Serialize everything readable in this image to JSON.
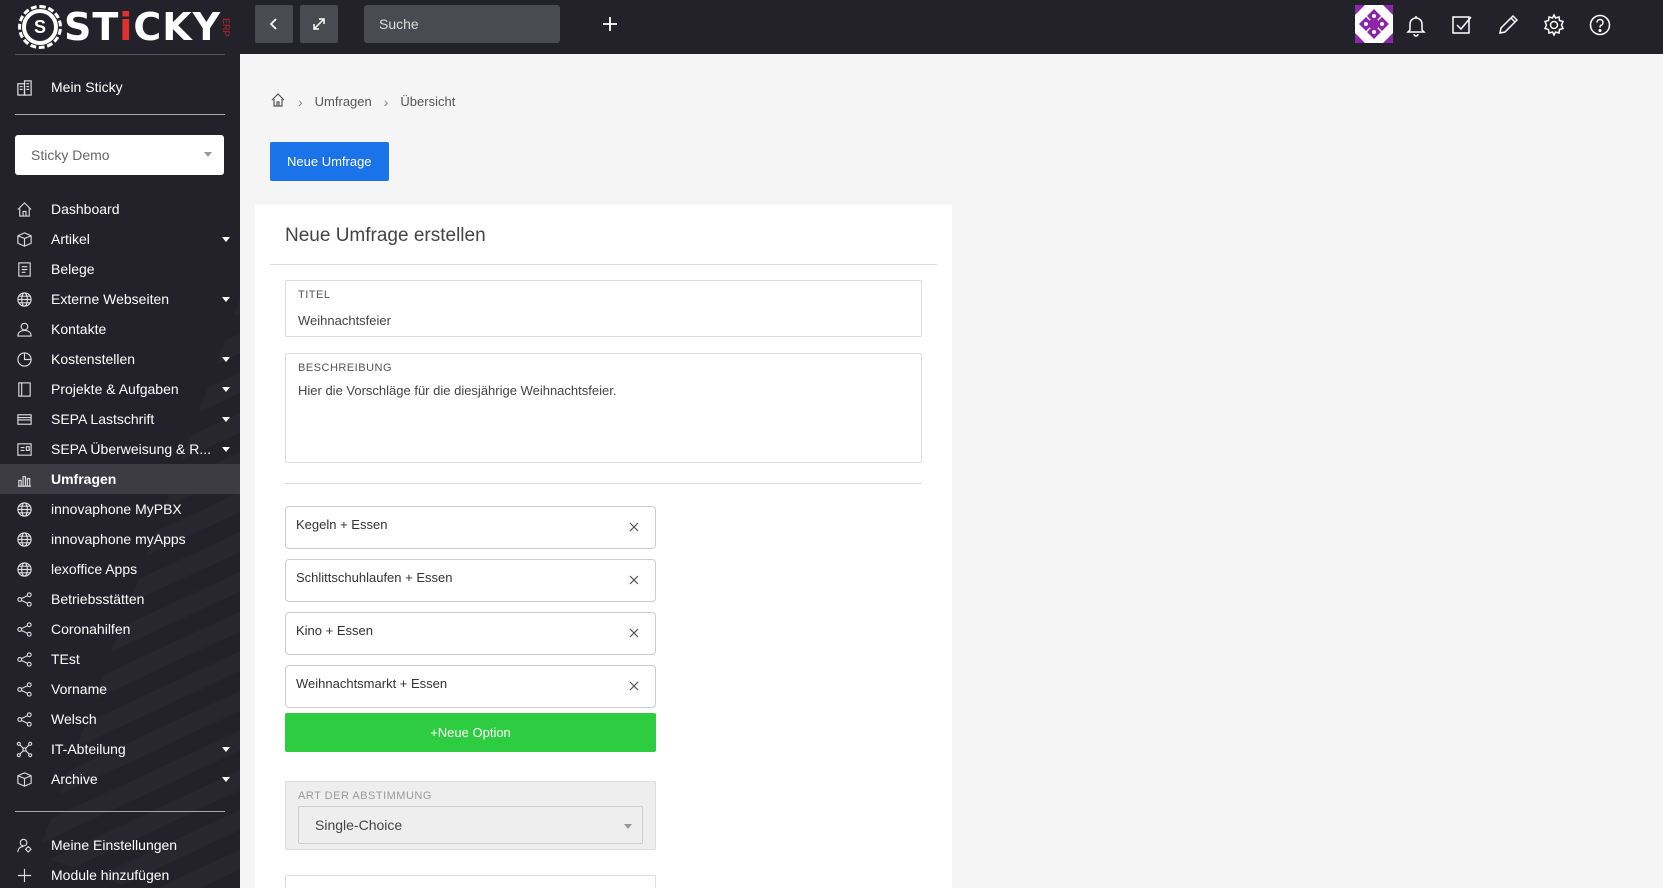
{
  "app": {
    "logo_text_a": "ST",
    "logo_text_b": "i",
    "logo_text_c": "CKY",
    "logo_sub": "ERP"
  },
  "sidebar": {
    "mein_sticky": "Mein Sticky",
    "org_select": "Sticky Demo",
    "items": [
      {
        "label": "Dashboard",
        "icon": "home-icon",
        "caret": false
      },
      {
        "label": "Artikel",
        "icon": "box-icon",
        "caret": true
      },
      {
        "label": "Belege",
        "icon": "document-icon",
        "caret": false
      },
      {
        "label": "Externe Webseiten",
        "icon": "globe-icon",
        "caret": true
      },
      {
        "label": "Kontakte",
        "icon": "contact-icon",
        "caret": false
      },
      {
        "label": "Kostenstellen",
        "icon": "pie-icon",
        "caret": true
      },
      {
        "label": "Projekte & Aufgaben",
        "icon": "book-icon",
        "caret": true
      },
      {
        "label": "SEPA Lastschrift",
        "icon": "card-icon",
        "caret": true
      },
      {
        "label": "SEPA Überweisung & R...",
        "icon": "transfer-icon",
        "caret": true
      },
      {
        "label": "Umfragen",
        "icon": "bar-chart-icon",
        "caret": false,
        "active": true
      },
      {
        "label": "innovaphone MyPBX",
        "icon": "globe-icon",
        "caret": false
      },
      {
        "label": "innovaphone myApps",
        "icon": "globe-icon",
        "caret": false
      },
      {
        "label": "lexoffice Apps",
        "icon": "globe-icon",
        "caret": false
      },
      {
        "label": "Betriebsstätten",
        "icon": "share-icon",
        "caret": false
      },
      {
        "label": "Coronahilfen",
        "icon": "share-icon",
        "caret": false
      },
      {
        "label": "TEst",
        "icon": "share-icon",
        "caret": false
      },
      {
        "label": "Vorname",
        "icon": "share-icon",
        "caret": false
      },
      {
        "label": "Welsch",
        "icon": "share-icon",
        "caret": false
      },
      {
        "label": "IT-Abteilung",
        "icon": "network-icon",
        "caret": true
      },
      {
        "label": "Archive",
        "icon": "box-icon",
        "caret": true
      }
    ],
    "bottom": [
      {
        "label": "Meine Einstellungen",
        "icon": "user-settings-icon"
      },
      {
        "label": "Module hinzufügen",
        "icon": "plus-icon"
      }
    ]
  },
  "topbar": {
    "search_placeholder": "Suche"
  },
  "breadcrumb": {
    "home_icon": "home-icon",
    "level1": "Umfragen",
    "level2": "Übersicht"
  },
  "main": {
    "new_button": "Neue Umfrage",
    "card_title": "Neue Umfrage erstellen",
    "title_label": "TITEL",
    "title_value": "Weihnachtsfeier",
    "desc_label": "BESCHREIBUNG",
    "desc_value": "Hier die Vorschläge für die diesjährige Weihnachtsfeier.",
    "options": [
      "Kegeln + Essen",
      "Schlittschuhlaufen + Essen",
      "Kino + Essen",
      "Weihnachtsmarkt + Essen"
    ],
    "new_option": "+Neue Option",
    "vote_label": "ART DER ABSTIMMUNG",
    "vote_value": "Single-Choice"
  },
  "colors": {
    "sidebar_bg": "#23222b",
    "primary": "#1a73e8",
    "success": "#2ecc40"
  }
}
